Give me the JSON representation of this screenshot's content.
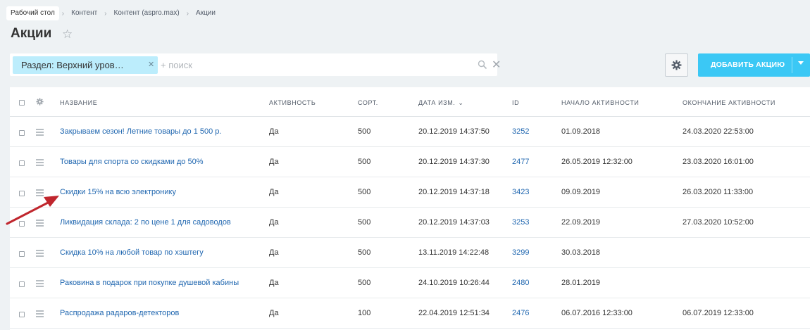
{
  "breadcrumb": [
    "Рабочий стол",
    "Контент",
    "Контент (aspro.max)",
    "Акции"
  ],
  "page_title": "Акции",
  "filter": {
    "tag_label": "Раздел: Верхний уров…",
    "search_placeholder": "+ поиск"
  },
  "toolbar": {
    "add_label": "ДОБАВИТЬ АКЦИЮ"
  },
  "columns": [
    "Название",
    "Активность",
    "Сорт.",
    "Дата изм.",
    "ID",
    "Начало активности",
    "Окончание активности"
  ],
  "sorted_column": "Дата изм.",
  "rows": [
    {
      "name": "Закрываем сезон! Летние товары до 1 500 р.",
      "active": "Да",
      "sort": "500",
      "modified": "20.12.2019 14:37:50",
      "id": "3252",
      "start": "01.09.2018",
      "end": "24.03.2020 22:53:00"
    },
    {
      "name": "Товары для спорта со скидками до 50%",
      "active": "Да",
      "sort": "500",
      "modified": "20.12.2019 14:37:30",
      "id": "2477",
      "start": "26.05.2019 12:32:00",
      "end": "23.03.2020 16:01:00"
    },
    {
      "name": "Скидки 15% на всю электронику",
      "active": "Да",
      "sort": "500",
      "modified": "20.12.2019 14:37:18",
      "id": "3423",
      "start": "09.09.2019",
      "end": "26.03.2020 11:33:00"
    },
    {
      "name": "Ликвидация склада: 2 по цене 1 для садоводов",
      "active": "Да",
      "sort": "500",
      "modified": "20.12.2019 14:37:03",
      "id": "3253",
      "start": "22.09.2019",
      "end": "27.03.2020 10:52:00"
    },
    {
      "name": "Скидка 10% на любой товар по хэштегу",
      "active": "Да",
      "sort": "500",
      "modified": "13.11.2019 14:22:48",
      "id": "3299",
      "start": "30.03.2018",
      "end": ""
    },
    {
      "name": "Раковина в подарок при покупке душевой кабины",
      "active": "Да",
      "sort": "500",
      "modified": "24.10.2019 10:26:44",
      "id": "2480",
      "start": "28.01.2019",
      "end": ""
    },
    {
      "name": "Распродажа радаров-детекторов",
      "active": "Да",
      "sort": "100",
      "modified": "22.04.2019 12:51:34",
      "id": "2476",
      "start": "06.07.2016 12:33:00",
      "end": "06.07.2019 12:33:00"
    }
  ],
  "colors": {
    "accent": "#3bc8f5",
    "link": "#2067b0",
    "filter_tag": "#bcedfc",
    "annotation_arrow": "#c0262d"
  }
}
